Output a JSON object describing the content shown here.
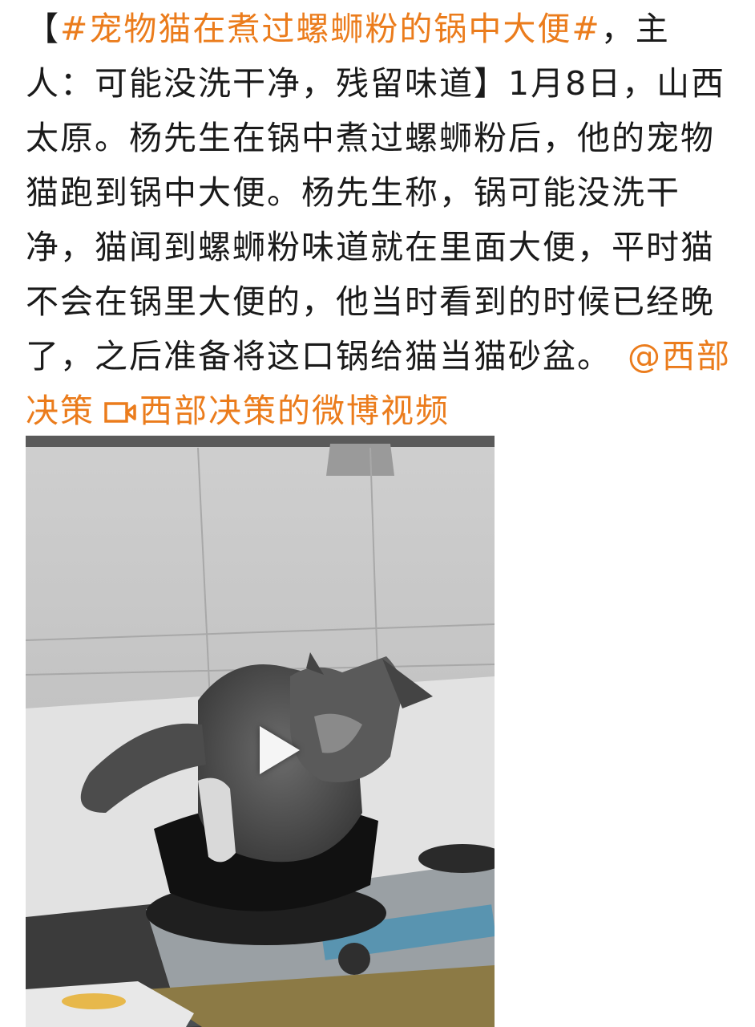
{
  "post": {
    "bracket_open": "【",
    "topic": "#宠物猫在煮过螺蛳粉的锅中大便#",
    "lead": "，主人：可能没洗干净，残留味道",
    "bracket_close": "】",
    "body": "1月8日，山西太原。杨先生在锅中煮过螺蛳粉后，他的宠物猫跑到锅中大便。杨先生称，锅可能没洗干净，猫闻到螺蛳粉味道就在里面大便，平时猫不会在锅里大便的，他当时看到的时候已经晚了，之后准备将这口锅给猫当猫砂盆。",
    "mention": "@西部决策",
    "video_link": "西部决策的微博视频"
  },
  "colors": {
    "link": "#eb7c1c",
    "text": "#1a1a1a"
  },
  "icons": {
    "video_link_icon": "video-camera-icon",
    "play_icon": "play-icon"
  }
}
